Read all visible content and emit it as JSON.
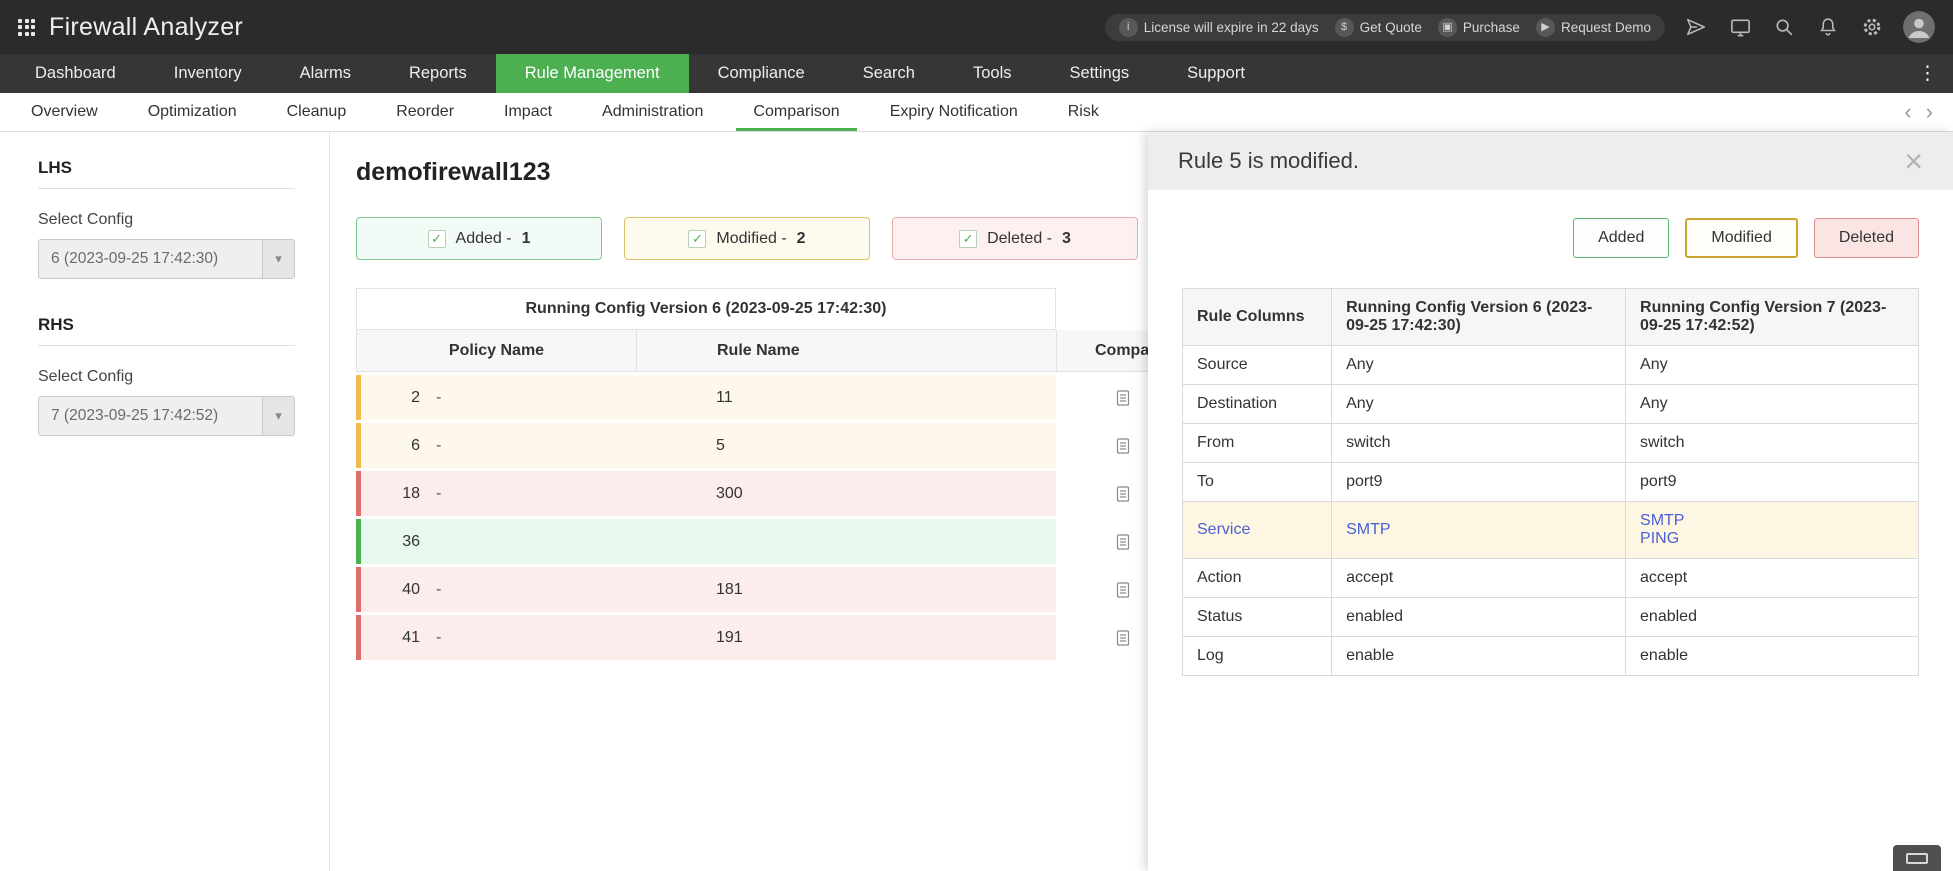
{
  "header": {
    "app_title": "Firewall Analyzer",
    "badges": [
      {
        "icon": "i",
        "label": "License will expire in 22 days"
      },
      {
        "icon": "$",
        "label": "Get Quote"
      },
      {
        "icon": "▣",
        "label": "Purchase"
      },
      {
        "icon": "▶",
        "label": "Request Demo"
      }
    ]
  },
  "nav": {
    "items": [
      {
        "label": "Dashboard",
        "active": false
      },
      {
        "label": "Inventory",
        "active": false
      },
      {
        "label": "Alarms",
        "active": false
      },
      {
        "label": "Reports",
        "active": false
      },
      {
        "label": "Rule Management",
        "active": true
      },
      {
        "label": "Compliance",
        "active": false
      },
      {
        "label": "Search",
        "active": false
      },
      {
        "label": "Tools",
        "active": false
      },
      {
        "label": "Settings",
        "active": false
      },
      {
        "label": "Support",
        "active": false
      }
    ],
    "more_icon": "⋮"
  },
  "subnav": {
    "items": [
      {
        "label": "Overview",
        "active": false
      },
      {
        "label": "Optimization",
        "active": false
      },
      {
        "label": "Cleanup",
        "active": false
      },
      {
        "label": "Reorder",
        "active": false
      },
      {
        "label": "Impact",
        "active": false
      },
      {
        "label": "Administration",
        "active": false
      },
      {
        "label": "Comparison",
        "active": true
      },
      {
        "label": "Expiry Notification",
        "active": false
      },
      {
        "label": "Risk",
        "active": false
      }
    ],
    "prev_icon": "‹",
    "next_icon": "›"
  },
  "sidebar": {
    "lhs_label": "LHS",
    "rhs_label": "RHS",
    "select_label_lhs": "Select Config",
    "select_label_rhs": "Select Config",
    "lhs_value": "6 (2023-09-25 17:42:30)",
    "rhs_value": "7 (2023-09-25 17:42:52)",
    "dropdown_icon": "▾"
  },
  "main": {
    "title": "demofirewall123",
    "filters": [
      {
        "type": "added",
        "label": "Added -",
        "count": "1"
      },
      {
        "type": "modified",
        "label": "Modified -",
        "count": "2"
      },
      {
        "type": "deleted",
        "label": "Deleted -",
        "count": "3"
      }
    ],
    "table": {
      "version_header": "Running Config Version 6 (2023-09-25 17:42:30)",
      "col_policy": "Policy Name",
      "col_rule": "Rule Name",
      "col_compare": "Compare",
      "rows": [
        {
          "type": "modified",
          "policy": "2",
          "dash": "-",
          "rule": "11"
        },
        {
          "type": "modified",
          "policy": "6",
          "dash": "-",
          "rule": "5"
        },
        {
          "type": "deleted",
          "policy": "18",
          "dash": "-",
          "rule": "300"
        },
        {
          "type": "added",
          "policy": "36",
          "dash": "",
          "rule": ""
        },
        {
          "type": "deleted",
          "policy": "40",
          "dash": "-",
          "rule": "181"
        },
        {
          "type": "deleted",
          "policy": "41",
          "dash": "-",
          "rule": "191"
        }
      ]
    }
  },
  "panel": {
    "title": "Rule 5 is modified.",
    "close_icon": "×",
    "buttons": [
      {
        "type": "added",
        "label": "Added"
      },
      {
        "type": "modified",
        "label": "Modified"
      },
      {
        "type": "deleted",
        "label": "Deleted"
      }
    ],
    "table": {
      "col0": "Rule Columns",
      "col1": "Running Config Version 6 (2023-09-25 17:42:30)",
      "col2": "Running Config Version 7 (2023-09-25 17:42:52)",
      "rows": [
        {
          "col": "Source",
          "v6": "Any",
          "v7": "Any"
        },
        {
          "col": "Destination",
          "v6": "Any",
          "v7": "Any"
        },
        {
          "col": "From",
          "v6": "switch",
          "v7": "switch"
        },
        {
          "col": "To",
          "v6": "port9",
          "v7": "port9"
        },
        {
          "col": "Service",
          "v6": "SMTP",
          "v7": "SMTP\nPING"
        },
        {
          "col": "Action",
          "v6": "accept",
          "v7": "accept"
        },
        {
          "col": "Status",
          "v6": "enabled",
          "v7": "enabled"
        },
        {
          "col": "Log",
          "v6": "enable",
          "v7": "enable"
        }
      ]
    }
  },
  "colors": {
    "accent_green": "#4caf50",
    "accent_yellow": "#ecbe4e",
    "accent_red": "#e06c6c",
    "link_blue": "#4a5fd4"
  }
}
